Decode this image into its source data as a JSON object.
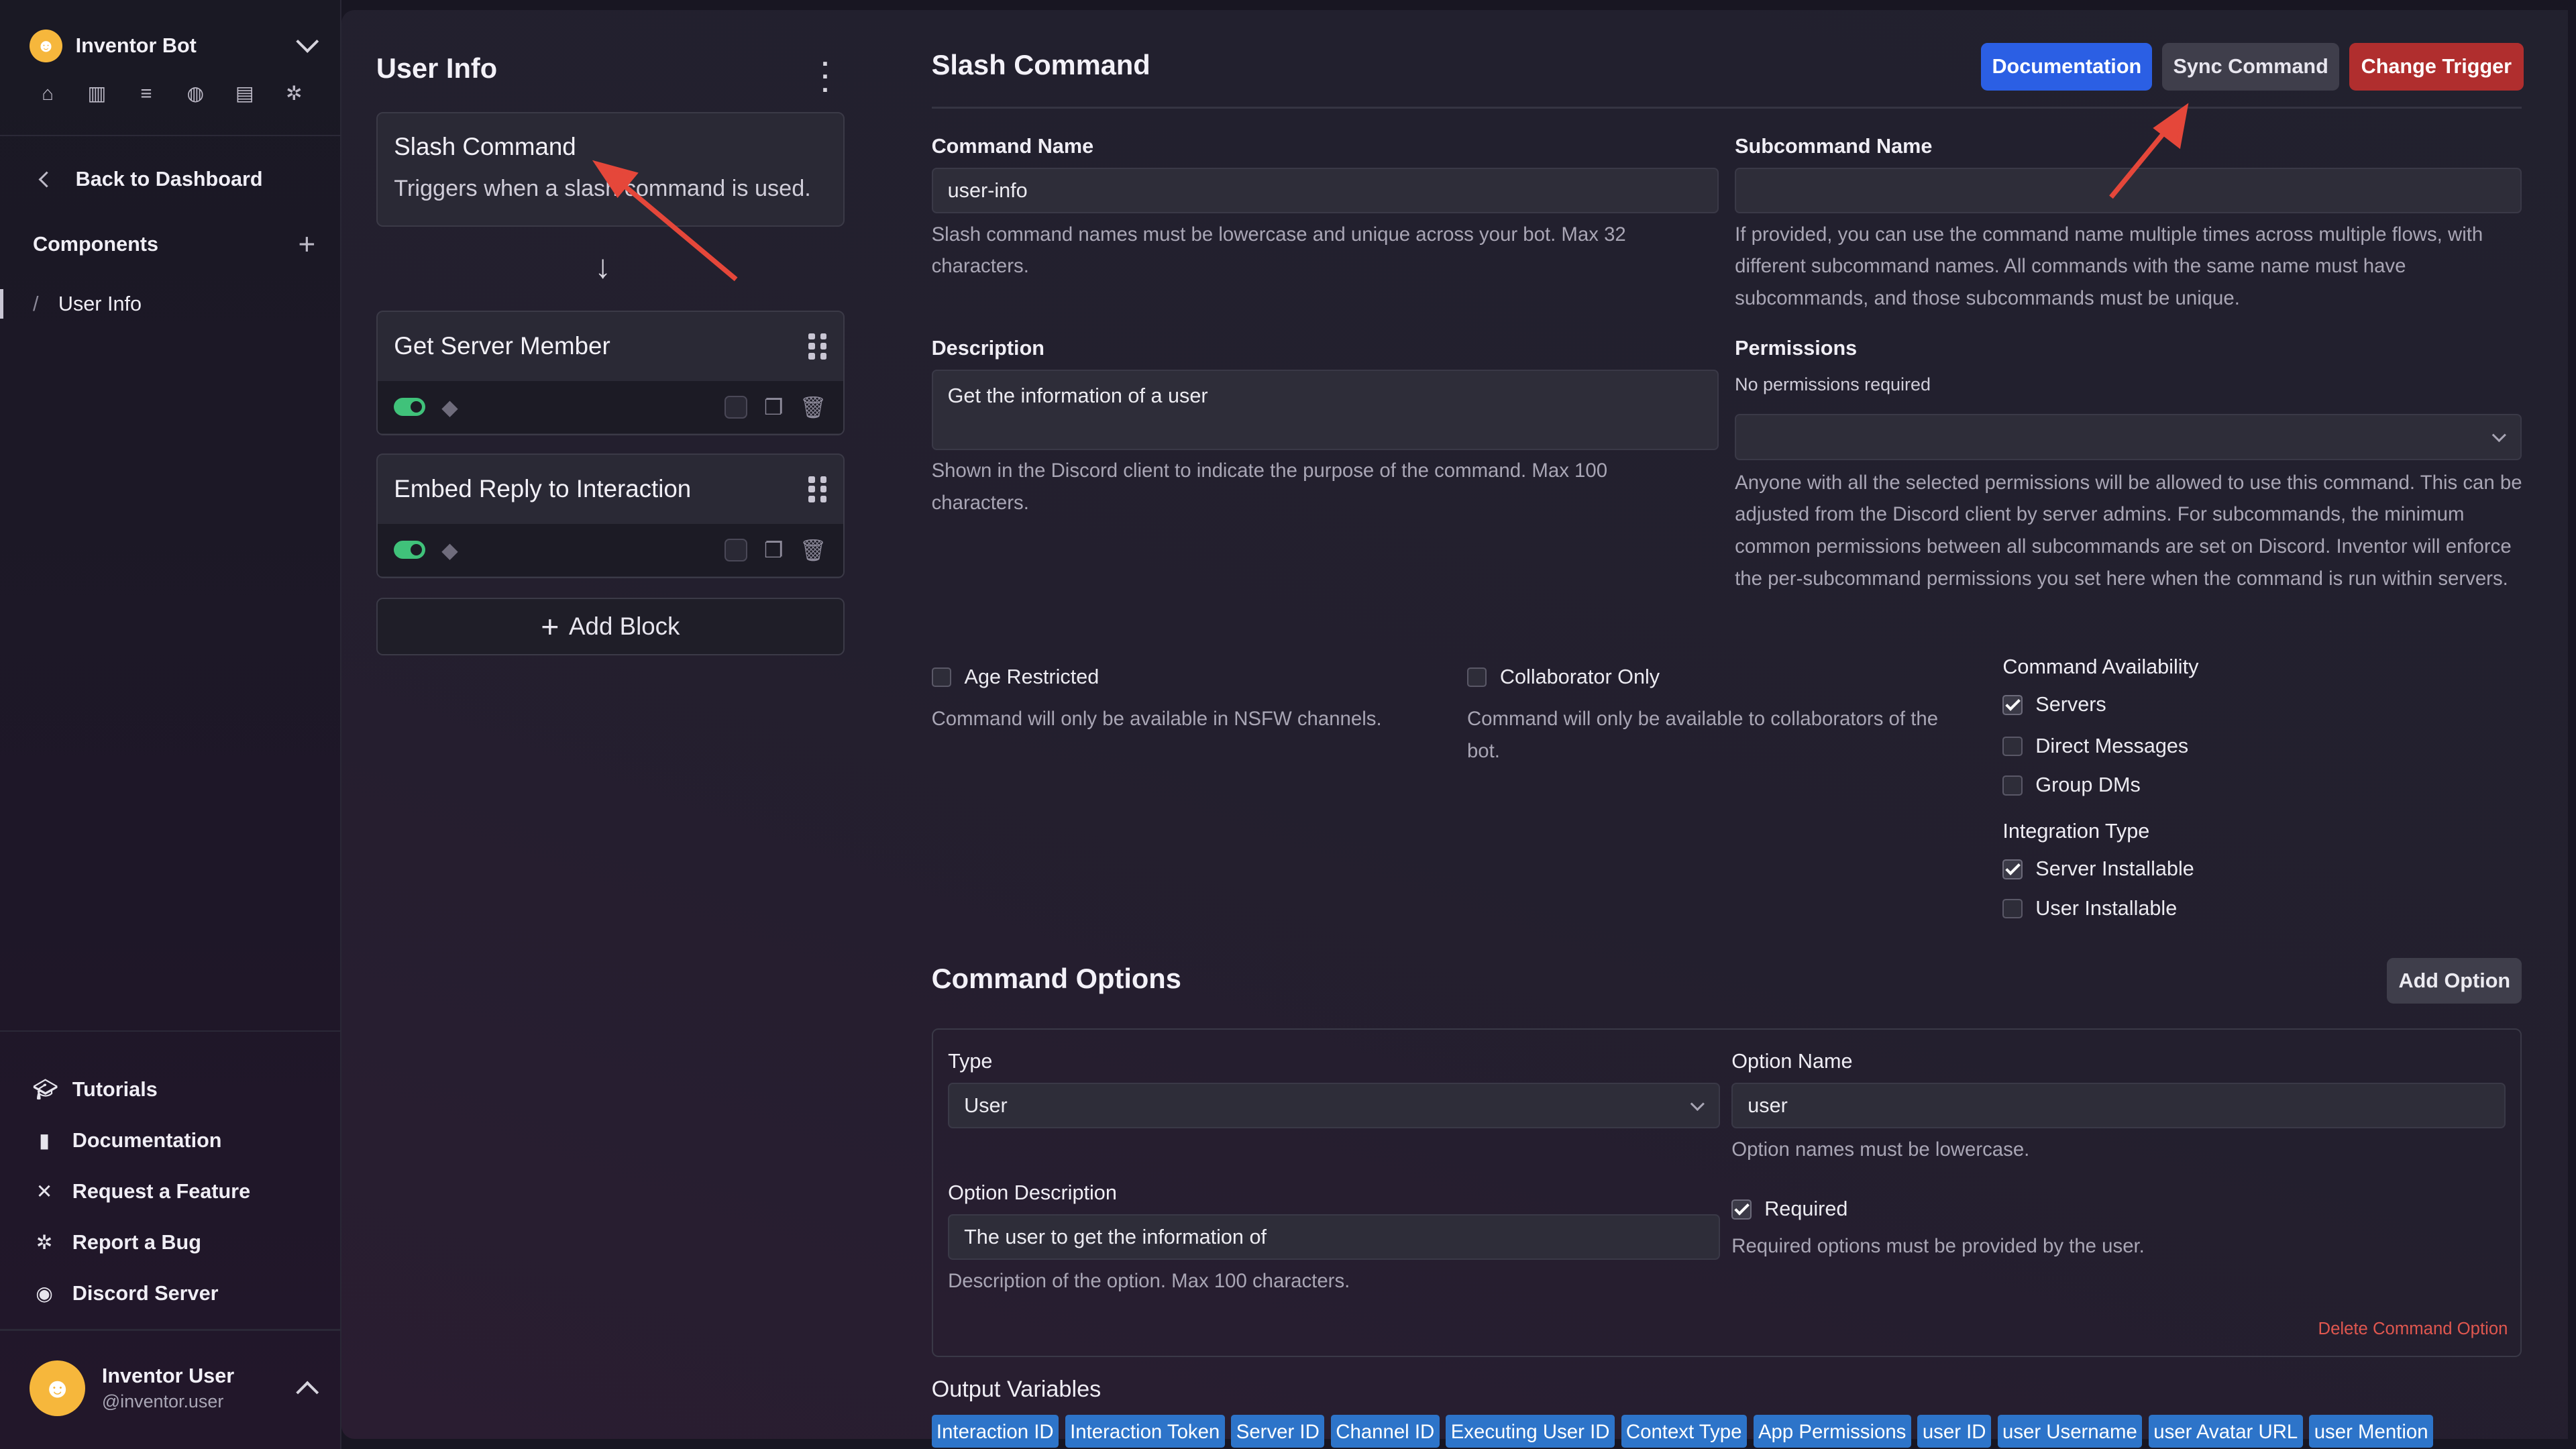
{
  "sidebar": {
    "bot_name": "Inventor Bot",
    "bot_icons": [
      "home-icon",
      "library-icon",
      "database-icon",
      "globe-icon",
      "server-icon",
      "bug-icon"
    ],
    "back_label": "Back to Dashboard",
    "components_label": "Components",
    "component_items": [
      {
        "label": "User Info"
      }
    ],
    "bottom_nav": [
      {
        "label": "Tutorials",
        "icon": "graduation-cap-icon"
      },
      {
        "label": "Documentation",
        "icon": "book-icon"
      },
      {
        "label": "Request a Feature",
        "icon": "tools-icon"
      },
      {
        "label": "Report a Bug",
        "icon": "bug-icon"
      },
      {
        "label": "Discord Server",
        "icon": "discord-icon"
      }
    ],
    "user": {
      "name": "Inventor User",
      "handle": "@inventor.user"
    }
  },
  "flow": {
    "title": "User Info",
    "trigger_block": {
      "title": "Slash Command",
      "description": "Triggers when a slash command is used."
    },
    "blocks": [
      {
        "title": "Get Server Member"
      },
      {
        "title": "Embed Reply to Interaction"
      }
    ],
    "add_block_label": "Add Block"
  },
  "form": {
    "title": "Slash Command",
    "buttons": {
      "documentation": "Documentation",
      "sync": "Sync Command",
      "change_trigger": "Change Trigger"
    },
    "command_name": {
      "label": "Command Name",
      "value": "user-info",
      "help": "Slash command names must be lowercase and unique across your bot. Max 32 characters."
    },
    "subcommand_name": {
      "label": "Subcommand Name",
      "value": "",
      "help": "If provided, you can use the command name multiple times across multiple flows, with different subcommand names. All commands with the same name must have subcommands, and those subcommands must be unique."
    },
    "description": {
      "label": "Description",
      "value": "Get the information of a user",
      "help": "Shown in the Discord client to indicate the purpose of the command. Max 100 characters."
    },
    "permissions": {
      "label": "Permissions",
      "status": "No permissions required",
      "help": "Anyone with all the selected permissions will be allowed to use this command. This can be adjusted from the Discord client by server admins. For subcommands, the minimum common permissions between all subcommands are set on Discord. Inventor will enforce the per-subcommand permissions you set here when the command is run within servers."
    },
    "age_restricted": {
      "label": "Age Restricted",
      "checked": false,
      "help": "Command will only be available in NSFW channels."
    },
    "collaborator_only": {
      "label": "Collaborator Only",
      "checked": false,
      "help": "Command will only be available to collaborators of the bot."
    },
    "availability": {
      "label": "Command Availability",
      "options": [
        {
          "label": "Servers",
          "checked": true
        },
        {
          "label": "Direct Messages",
          "checked": false
        },
        {
          "label": "Group DMs",
          "checked": false
        }
      ]
    },
    "integration": {
      "label": "Integration Type",
      "options": [
        {
          "label": "Server Installable",
          "checked": true
        },
        {
          "label": "User Installable",
          "checked": false
        }
      ]
    }
  },
  "options_section": {
    "title": "Command Options",
    "add_label": "Add Option",
    "option": {
      "type_label": "Type",
      "type_value": "User",
      "name_label": "Option Name",
      "name_value": "user",
      "name_help": "Option names must be lowercase.",
      "description_label": "Option Description",
      "description_value": "The user to get the information of",
      "description_help": "Description of the option. Max 100 characters.",
      "required_label": "Required",
      "required_checked": true,
      "required_help": "Required options must be provided by the user.",
      "delete_label": "Delete Command Option"
    }
  },
  "output_variables": {
    "title": "Output Variables",
    "items": [
      "Interaction ID",
      "Interaction Token",
      "Server ID",
      "Channel ID",
      "Executing User ID",
      "Context Type",
      "App Permissions",
      "user ID",
      "user Username",
      "user Avatar URL",
      "user Mention"
    ]
  },
  "colors": {
    "accent_blue": "#2b5fe4",
    "danger_red": "#b02e2e",
    "toggle_green": "#40c27a",
    "variable_blue": "#2d74c9",
    "annotation_red": "#e5473a"
  }
}
